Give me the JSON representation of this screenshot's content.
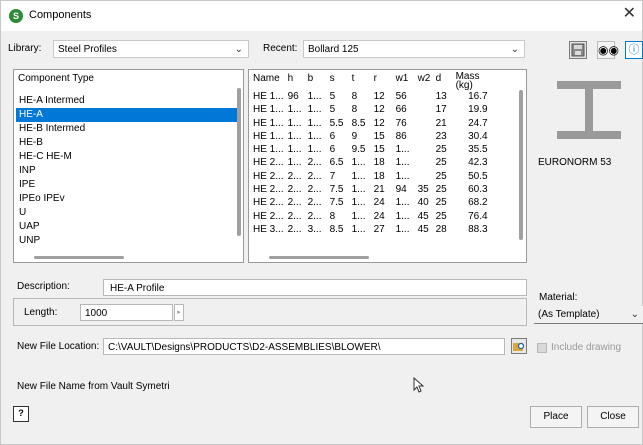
{
  "window": {
    "title": "Components",
    "close_glyph": "✕",
    "app_icon_letter": "S"
  },
  "library": {
    "label": "Library:",
    "value": "Steel Profiles"
  },
  "recent": {
    "label": "Recent:",
    "value": "Bollard 125"
  },
  "toolbar": {
    "icons": [
      "save-icon",
      "binoculars-icon",
      "info-icon"
    ]
  },
  "component_types": {
    "header": "Component Type",
    "items": [
      "HE-A Intermed",
      "HE-A",
      "HE-B Intermed",
      "HE-B",
      "HE-C HE-M",
      "INP",
      "IPE",
      "IPEo IPEv",
      "U",
      "UAP",
      "UNP"
    ],
    "selected_index": 1
  },
  "profile_table": {
    "columns": [
      "Name",
      "h",
      "b",
      "s",
      "t",
      "r",
      "w1",
      "w2",
      "d",
      "Mass (kg)"
    ],
    "rows": [
      [
        "HE 1...",
        "96",
        "1...",
        "5",
        "8",
        "12",
        "56",
        "",
        "13",
        "16.7"
      ],
      [
        "HE 1...",
        "1...",
        "1...",
        "5",
        "8",
        "12",
        "66",
        "",
        "17",
        "19.9"
      ],
      [
        "HE 1...",
        "1...",
        "1...",
        "5.5",
        "8.5",
        "12",
        "76",
        "",
        "21",
        "24.7"
      ],
      [
        "HE 1...",
        "1...",
        "1...",
        "6",
        "9",
        "15",
        "86",
        "",
        "23",
        "30.4"
      ],
      [
        "HE 1...",
        "1...",
        "1...",
        "6",
        "9.5",
        "15",
        "1...",
        "",
        "25",
        "35.5"
      ],
      [
        "HE 2...",
        "1...",
        "2...",
        "6.5",
        "1...",
        "18",
        "1...",
        "",
        "25",
        "42.3"
      ],
      [
        "HE 2...",
        "2...",
        "2...",
        "7",
        "1...",
        "18",
        "1...",
        "",
        "25",
        "50.5"
      ],
      [
        "HE 2...",
        "2...",
        "2...",
        "7.5",
        "1...",
        "21",
        "94",
        "35",
        "25",
        "60.3"
      ],
      [
        "HE 2...",
        "2...",
        "2...",
        "7.5",
        "1...",
        "24",
        "1...",
        "40",
        "25",
        "68.2"
      ],
      [
        "HE 2...",
        "2...",
        "2...",
        "8",
        "1...",
        "24",
        "1...",
        "45",
        "25",
        "76.4"
      ],
      [
        "HE 3...",
        "2...",
        "3...",
        "8.5",
        "1...",
        "27",
        "1...",
        "45",
        "28",
        "88.3"
      ]
    ]
  },
  "preview": {
    "standard": "EURONORM 53",
    "icon": "i-beam-icon"
  },
  "description": {
    "label": "Description:",
    "value": "HE-A Profile"
  },
  "length": {
    "label": "Length:",
    "value": "1000"
  },
  "material": {
    "label": "Material:",
    "value": "(As Template)"
  },
  "file_location": {
    "label": "New File Location:",
    "value": "C:\\VAULT\\Designs\\PRODUCTS\\D2-ASSEMBLIES\\BLOWER\\"
  },
  "include_drawing": {
    "label": "Include drawing",
    "checked": true,
    "enabled": false
  },
  "file_name": {
    "label": "New File Name from Vault Symetri"
  },
  "buttons": {
    "place": "Place",
    "close": "Close",
    "help": "?"
  }
}
